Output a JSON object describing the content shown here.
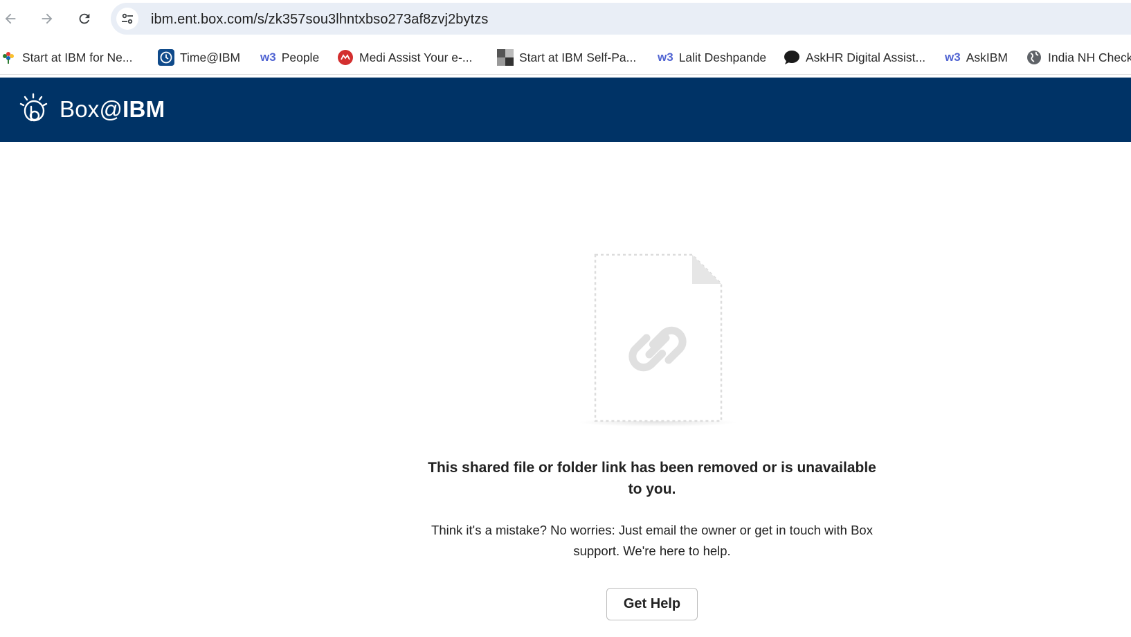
{
  "browser": {
    "back_icon": "arrow-left-icon",
    "forward_icon": "arrow-right-icon",
    "reload_icon": "reload-icon",
    "site_info_icon": "tune-icon",
    "url": "ibm.ent.box.com/s/zk357sou3lhntxbso273af8zvj2bytzs"
  },
  "bookmarks": [
    {
      "label": "Start at IBM for Ne...",
      "icon": "flower-icon"
    },
    {
      "label": "Time@IBM",
      "icon": "clock-icon"
    },
    {
      "label": "People",
      "icon": "w3-icon",
      "badge": "w3"
    },
    {
      "label": "Medi Assist Your e-...",
      "icon": "medi-assist-icon"
    },
    {
      "label": "Start at IBM Self-Pa...",
      "icon": "pixel-grid-icon"
    },
    {
      "label": "Lalit Deshpande",
      "icon": "w3-icon",
      "badge": "w3"
    },
    {
      "label": "AskHR Digital Assist...",
      "icon": "chat-bubble-icon"
    },
    {
      "label": "AskIBM",
      "icon": "w3-icon",
      "badge": "w3"
    },
    {
      "label": "India NH Check",
      "icon": "globe-icon"
    }
  ],
  "header": {
    "brand_prefix": "Box@",
    "brand_suffix": "IBM",
    "logo_icon": "box-ibm-logo-icon",
    "colors": {
      "bar": "#003366"
    }
  },
  "empty_state": {
    "illustration_icon": "broken-link-file-icon",
    "title": "This shared file or folder link has been removed or is unavailable to you.",
    "body": "Think it's a mistake? No worries: Just email the owner or get in touch with Box support. We're here to help.",
    "button_label": "Get Help"
  }
}
